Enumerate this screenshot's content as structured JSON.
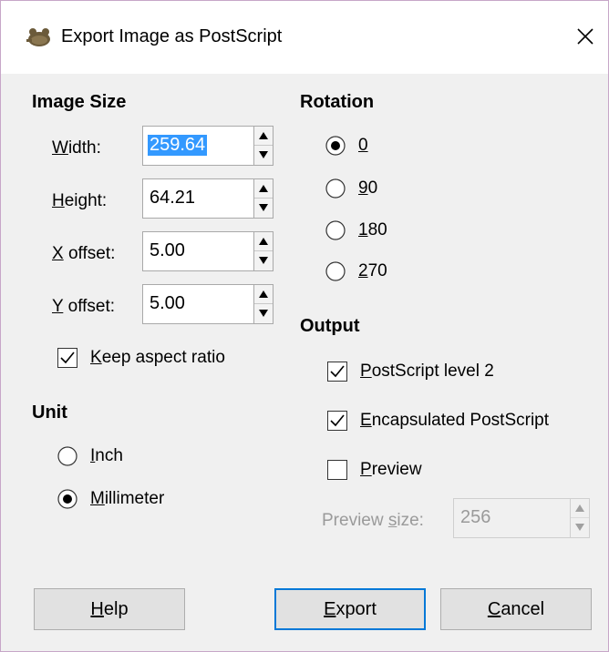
{
  "window": {
    "title": "Export Image as PostScript"
  },
  "image_size": {
    "heading": "Image Size",
    "width": {
      "label_u": "W",
      "label_rest": "idth:",
      "value": "259.64"
    },
    "height": {
      "label_u": "H",
      "label_rest": "eight:",
      "value": "64.21"
    },
    "x_offset": {
      "label_u": "X",
      "label_rest": " offset:",
      "value": "5.00"
    },
    "y_offset": {
      "label_u": "Y",
      "label_rest": " offset:",
      "value": "5.00"
    },
    "keep_aspect": {
      "label_u": "K",
      "label_rest": "eep aspect ratio",
      "checked": true
    }
  },
  "unit": {
    "heading": "Unit",
    "inch": {
      "label_u": "I",
      "label_rest": "nch",
      "selected": false
    },
    "millimeter": {
      "label_u": "M",
      "label_rest": "illimeter",
      "selected": true
    }
  },
  "rotation": {
    "heading": "Rotation",
    "r0": {
      "label_u": "0",
      "label_rest": "",
      "selected": true
    },
    "r90": {
      "label_u": "9",
      "label_rest": "0",
      "selected": false
    },
    "r180": {
      "label_u": "1",
      "label_rest": "80",
      "selected": false
    },
    "r270": {
      "label_u": "2",
      "label_rest": "70",
      "selected": false
    }
  },
  "output": {
    "heading": "Output",
    "ps_level2": {
      "label_u": "P",
      "label_rest": "ostScript level 2",
      "checked": true
    },
    "encapsulated": {
      "label_u": "E",
      "label_rest": "ncapsulated PostScript",
      "checked": true
    },
    "preview": {
      "label_u": "P",
      "label_rest": "review",
      "checked": false
    },
    "preview_size": {
      "label_pre": "Preview ",
      "label_u": "s",
      "label_rest": "ize:",
      "value": "256"
    }
  },
  "buttons": {
    "help": {
      "label_u": "H",
      "label_rest": "elp"
    },
    "export": {
      "label_u": "E",
      "label_rest": "xport"
    },
    "cancel": {
      "label_u": "C",
      "label_rest": "ancel"
    }
  },
  "colors": {
    "accent": "#0078d7",
    "selection": "#3399ff",
    "window_border": "#c7a6c8"
  }
}
